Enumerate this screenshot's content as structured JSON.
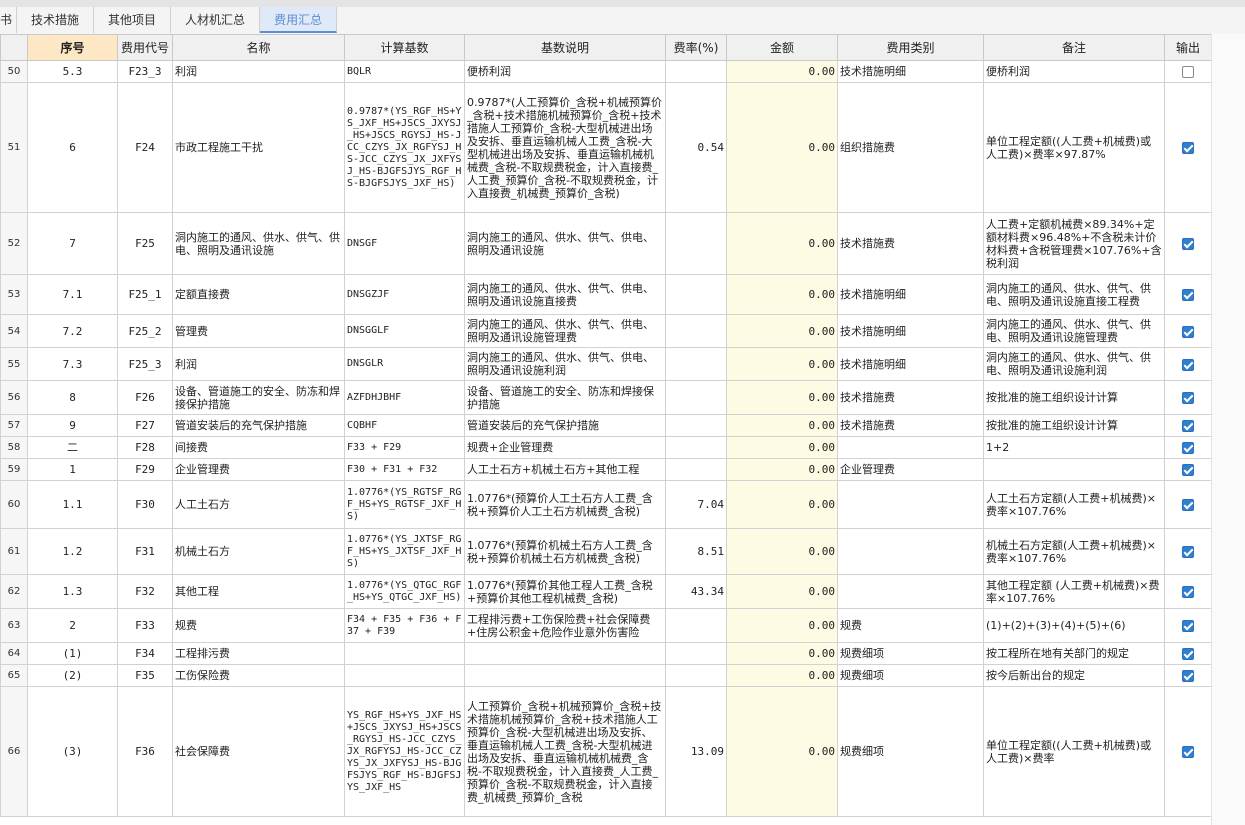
{
  "tabs": [
    {
      "label": "书",
      "active": false
    },
    {
      "label": "技术措施",
      "active": false
    },
    {
      "label": "其他项目",
      "active": false
    },
    {
      "label": "人材机汇总",
      "active": false
    },
    {
      "label": "费用汇总",
      "active": true
    }
  ],
  "columns": {
    "seq": "序号",
    "code": "费用代号",
    "name": "名称",
    "base": "计算基数",
    "desc": "基数说明",
    "rate": "费率(%)",
    "amount": "金额",
    "category": "费用类别",
    "note": "备注",
    "output": "输出"
  },
  "rows": [
    {
      "rn": "50",
      "seq": "5.3",
      "code": "F23_3",
      "name": "利润",
      "base": "BQLR",
      "desc": "便桥利润",
      "rate": "",
      "amount": "0.00",
      "category": "技术措施明细",
      "note": "便桥利润",
      "output": false
    },
    {
      "rn": "51",
      "seq": "6",
      "code": "F24",
      "name": "市政工程施工干扰",
      "base": "0.9787*(YS_RGF_HS+YS_JXF_HS+JSCS_JXYSJ_HS+JSCS_RGYSJ_HS-JCC_CZYS_JX_RGFYSJ_HS-JCC_CZYS_JX_JXFYSJ_HS-BJGFSJYS_RGF_HS-BJGFSJYS_JXF_HS)",
      "desc": "0.9787*(人工预算价_含税+机械预算价_含税+技术措施机械预算价_含税+技术措施人工预算价_含税-大型机械进出场及安拆、垂直运输机械人工费_含税-大型机械进出场及安拆、垂直运输机械机械费_含税-不取规费税金，计入直接费_人工费_预算价_含税-不取规费税金，计入直接费_机械费_预算价_含税)",
      "rate": "0.54",
      "amount": "0.00",
      "category": "组织措施费",
      "note": "单位工程定额((人工费+机械费)或人工费)×费率×97.87%",
      "output": true
    },
    {
      "rn": "52",
      "seq": "7",
      "code": "F25",
      "name": "洞内施工的通风、供水、供气、供电、照明及通讯设施",
      "base": "DNSGF",
      "desc": "洞内施工的通风、供水、供气、供电、照明及通讯设施",
      "rate": "",
      "amount": "0.00",
      "category": "技术措施费",
      "note": "人工费+定额机械费×89.34%+定额材料费×96.48%+不含税未计价材料费+含税管理费×107.76%+含税利润",
      "output": true
    },
    {
      "rn": "53",
      "seq": "7.1",
      "code": "F25_1",
      "name": "定额直接费",
      "base": "DNSGZJF",
      "desc": "洞内施工的通风、供水、供气、供电、照明及通讯设施直接费",
      "rate": "",
      "amount": "0.00",
      "category": "技术措施明细",
      "note": "洞内施工的通风、供水、供气、供电、照明及通讯设施直接工程费",
      "output": true
    },
    {
      "rn": "54",
      "seq": "7.2",
      "code": "F25_2",
      "name": "管理费",
      "base": "DNSGGLF",
      "desc": "洞内施工的通风、供水、供气、供电、照明及通讯设施管理费",
      "rate": "",
      "amount": "0.00",
      "category": "技术措施明细",
      "note": "洞内施工的通风、供水、供气、供电、照明及通讯设施管理费",
      "output": true
    },
    {
      "rn": "55",
      "seq": "7.3",
      "code": "F25_3",
      "name": "利润",
      "base": "DNSGLR",
      "desc": "洞内施工的通风、供水、供气、供电、照明及通讯设施利润",
      "rate": "",
      "amount": "0.00",
      "category": "技术措施明细",
      "note": "洞内施工的通风、供水、供气、供电、照明及通讯设施利润",
      "output": true
    },
    {
      "rn": "56",
      "seq": "8",
      "code": "F26",
      "name": "设备、管道施工的安全、防冻和焊接保护措施",
      "base": "AZFDHJBHF",
      "desc": "设备、管道施工的安全、防冻和焊接保护措施",
      "rate": "",
      "amount": "0.00",
      "category": "技术措施费",
      "note": "按批准的施工组织设计计算",
      "output": true
    },
    {
      "rn": "57",
      "seq": "9",
      "code": "F27",
      "name": "管道安装后的充气保护措施",
      "base": "CQBHF",
      "desc": "管道安装后的充气保护措施",
      "rate": "",
      "amount": "0.00",
      "category": "技术措施费",
      "note": "按批准的施工组织设计计算",
      "output": true
    },
    {
      "rn": "58",
      "seq": "二",
      "code": "F28",
      "name": "间接费",
      "base": "F33 + F29",
      "desc": "规费+企业管理费",
      "rate": "",
      "amount": "0.00",
      "category": "",
      "note": "1+2",
      "output": true
    },
    {
      "rn": "59",
      "seq": "1",
      "code": "F29",
      "name": "企业管理费",
      "base": "F30 + F31 + F32",
      "desc": "人工土石方+机械土石方+其他工程",
      "rate": "",
      "amount": "0.00",
      "category": "企业管理费",
      "note": "",
      "output": true
    },
    {
      "rn": "60",
      "seq": "1.1",
      "code": "F30",
      "name": "人工土石方",
      "base": "1.0776*(YS_RGTSF_RGF_HS+YS_RGTSF_JXF_HS)",
      "desc": "1.0776*(预算价人工土石方人工费_含税+预算价人工土石方机械费_含税)",
      "rate": "7.04",
      "amount": "0.00",
      "category": "",
      "note": "人工土石方定额(人工费+机械费)×费率×107.76%",
      "output": true
    },
    {
      "rn": "61",
      "seq": "1.2",
      "code": "F31",
      "name": "机械土石方",
      "base": "1.0776*(YS_JXTSF_RGF_HS+YS_JXTSF_JXF_HS)",
      "desc": "1.0776*(预算价机械土石方人工费_含税+预算价机械土石方机械费_含税)",
      "rate": "8.51",
      "amount": "0.00",
      "category": "",
      "note": "机械土石方定额(人工费+机械费)×费率×107.76%",
      "output": true
    },
    {
      "rn": "62",
      "seq": "1.3",
      "code": "F32",
      "name": "其他工程",
      "base": "1.0776*(YS_QTGC_RGF_HS+YS_QTGC_JXF_HS)",
      "desc": "1.0776*(预算价其他工程人工费_含税+预算价其他工程机械费_含税)",
      "rate": "43.34",
      "amount": "0.00",
      "category": "",
      "note": "其他工程定额 (人工费+机械费)×费率×107.76%",
      "output": true
    },
    {
      "rn": "63",
      "seq": "2",
      "code": "F33",
      "name": "规费",
      "base": "F34 + F35 + F36 + F37 + F39",
      "desc": "工程排污费+工伤保险费+社会保障费+住房公积金+危险作业意外伤害险",
      "rate": "",
      "amount": "0.00",
      "category": "规费",
      "note": "(1)+(2)+(3)+(4)+(5)+(6)",
      "output": true
    },
    {
      "rn": "64",
      "seq": "(1)",
      "code": "F34",
      "name": "工程排污费",
      "base": "",
      "desc": "",
      "rate": "",
      "amount": "0.00",
      "category": "规费细项",
      "note": "按工程所在地有关部门的规定",
      "output": true
    },
    {
      "rn": "65",
      "seq": "(2)",
      "code": "F35",
      "name": "工伤保险费",
      "base": "",
      "desc": "",
      "rate": "",
      "amount": "0.00",
      "category": "规费细项",
      "note": "按今后新出台的规定",
      "output": true
    },
    {
      "rn": "66",
      "seq": "(3)",
      "code": "F36",
      "name": "社会保障费",
      "base": "YS_RGF_HS+YS_JXF_HS+JSCS_JXYSJ_HS+JSCS_RGYSJ_HS-JCC_CZYS_JX_RGFYSJ_HS-JCC_CZYS_JX_JXFYSJ_HS-BJGFSJYS_RGF_HS-BJGFSJYS_JXF_HS",
      "desc": "人工预算价_含税+机械预算价_含税+技术措施机械预算价_含税+技术措施人工预算价_含税-大型机械进出场及安拆、垂直运输机械人工费_含税-大型机械进出场及安拆、垂直运输机械机械费_含税-不取规费税金，计入直接费_人工费_预算价_含税-不取规费税金，计入直接费_机械费_预算价_含税",
      "rate": "13.09",
      "amount": "0.00",
      "category": "规费细项",
      "note": "单位工程定额((人工费+机械费)或人工费)×费率",
      "output": true
    }
  ]
}
